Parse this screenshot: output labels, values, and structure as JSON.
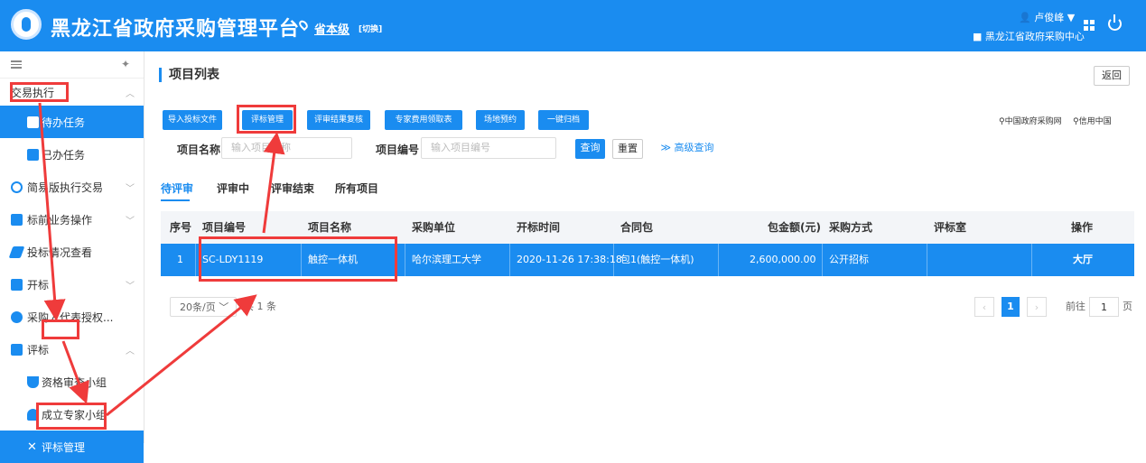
{
  "header": {
    "title": "黑龙江省政府采购管理平台",
    "level": "省本级",
    "switch": "[切换]",
    "user": "卢俊峰",
    "org": "黑龙江省政府采购中心"
  },
  "sidebar": {
    "items": [
      {
        "label": "交易执行"
      },
      {
        "label": "待办任务"
      },
      {
        "label": "已办任务"
      },
      {
        "label": "简易版执行交易"
      },
      {
        "label": "标前业务操作"
      },
      {
        "label": "投标情况查看"
      },
      {
        "label": "开标"
      },
      {
        "label": "采购人代表授权..."
      },
      {
        "label": "评标"
      },
      {
        "label": "资格审查小组"
      },
      {
        "label": "成立专家小组"
      },
      {
        "label": "评标管理"
      }
    ]
  },
  "main": {
    "title": "项目列表",
    "back": "返回",
    "toolbar": [
      "导入投标文件",
      "评标管理",
      "评审结果复核",
      "专家费用领取表",
      "场地预约",
      "一键归档"
    ],
    "links": [
      "中国政府采购网",
      "信用中国"
    ],
    "search": {
      "name_label": "项目名称",
      "name_ph": "输入项目名称",
      "code_label": "项目编号",
      "code_ph": "输入项目编号",
      "query": "查询",
      "reset": "重置",
      "advanced": "高级查询"
    },
    "tabs": [
      "待评审",
      "评审中",
      "评审结束",
      "所有项目"
    ],
    "table": {
      "headers": [
        "序号",
        "项目编号",
        "项目名称",
        "采购单位",
        "开标时间",
        "合同包",
        "包金额(元)",
        "采购方式",
        "评标室",
        "操作"
      ],
      "row": [
        "1",
        "SC-LDY1119",
        "触控一体机",
        "哈尔滨理工大学",
        "2020-11-26 17:38:18",
        "包1(触控一体机)",
        "2,600,000.00",
        "公开招标",
        "",
        "大厅"
      ]
    },
    "pagination": {
      "size": "20条/页",
      "total": "共 1 条",
      "page": "1",
      "goto": "前往",
      "goto_val": "1",
      "unit": "页"
    }
  },
  "colors": {
    "primary": "#1a8cf0",
    "highlight": "#ef3b3b"
  }
}
